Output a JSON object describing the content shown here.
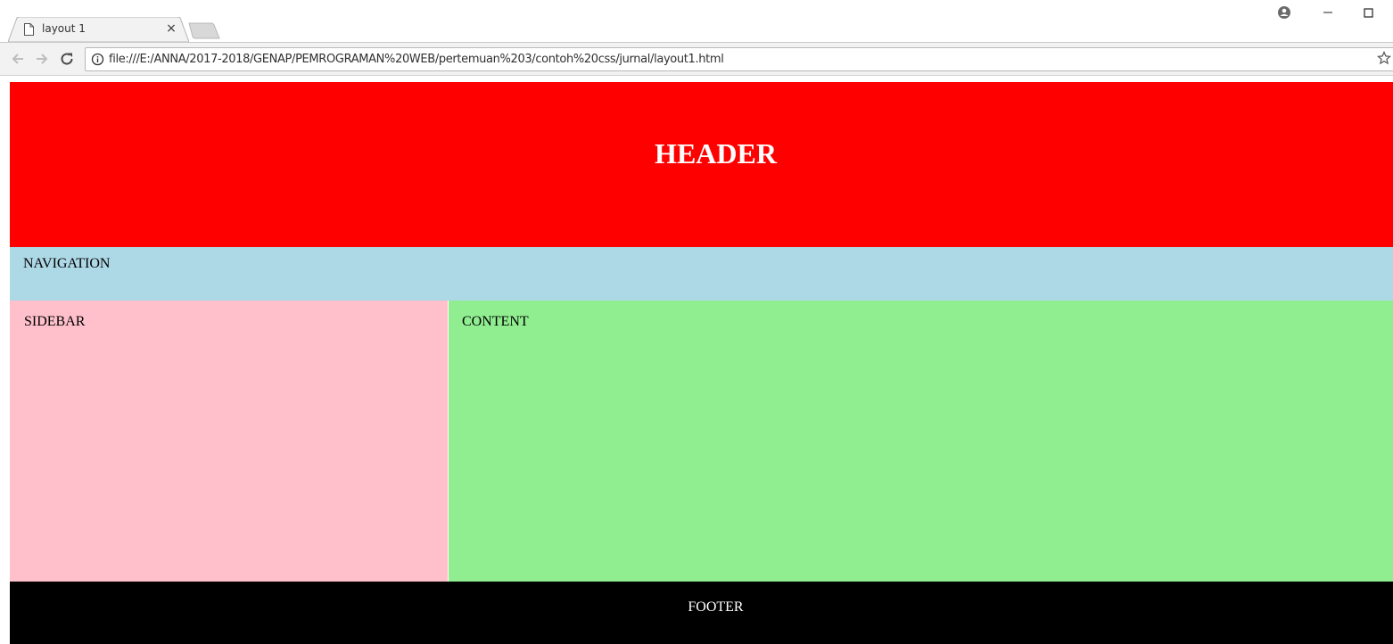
{
  "browser": {
    "tab": {
      "title": "layout 1",
      "close_label": "×"
    },
    "address_bar": {
      "url": "file:///E:/ANNA/2017-2018/GENAP/PEMROGRAMAN%20WEB/pertemuan%203/contoh%20css/jurnal/layout1.html"
    },
    "icons": [
      "page-icon",
      "close-icon",
      "new-tab-icon",
      "profile-icon",
      "minimize-icon",
      "maximize-icon",
      "back-arrow-icon",
      "forward-arrow-icon",
      "reload-icon",
      "info-icon",
      "star-icon"
    ]
  },
  "page": {
    "header": {
      "title": "HEADER",
      "background": "#ff0000",
      "text_color": "#ffffff"
    },
    "navigation": {
      "label": "NAVIGATION",
      "background": "#add8e6"
    },
    "sidebar": {
      "label": "SIDEBAR",
      "background": "#ffc0cb"
    },
    "content": {
      "label": "CONTENT",
      "background": "#90ee90"
    },
    "footer": {
      "label": "FOOTER",
      "background": "#000000",
      "text_color": "#ffffff"
    }
  }
}
